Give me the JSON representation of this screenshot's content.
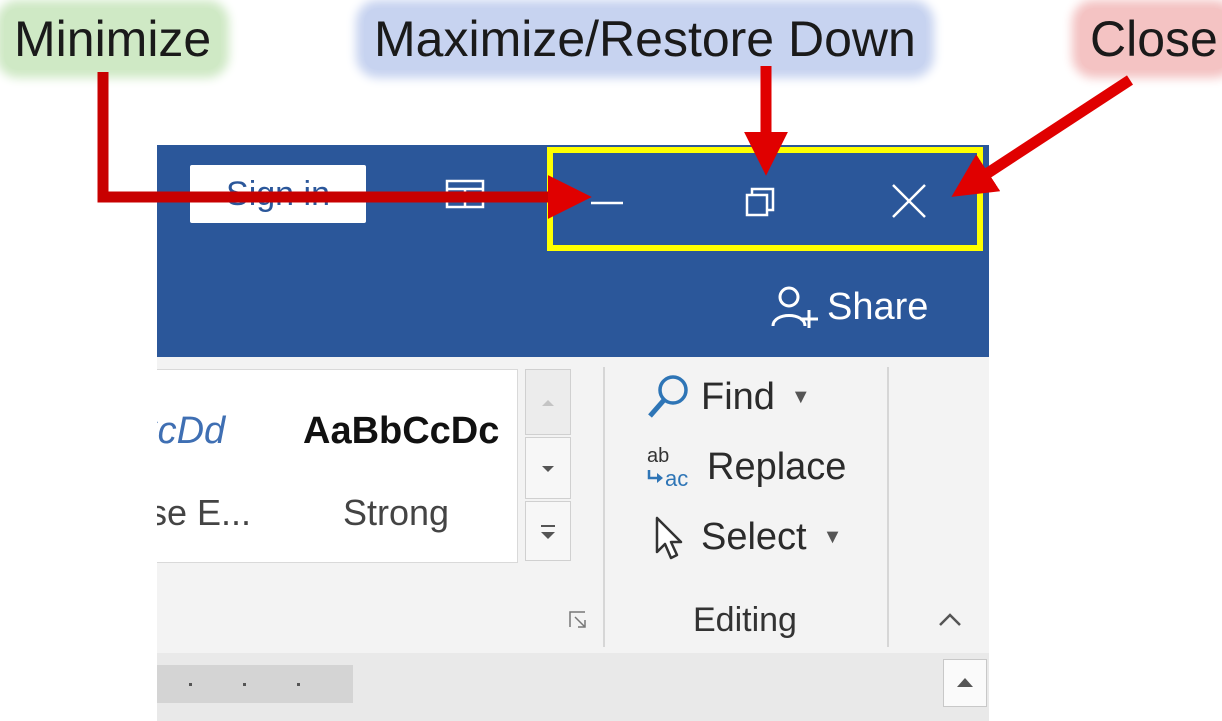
{
  "callouts": {
    "minimize": "Minimize",
    "maximize": "Maximize/Restore Down",
    "close": "Close"
  },
  "titlebar": {
    "sign_in": "Sign in",
    "share": "Share",
    "controls": [
      "minimize-icon",
      "restore-icon",
      "close-icon"
    ]
  },
  "ribbon": {
    "styles": [
      {
        "sample": "AaBbCcDd",
        "name": "Subtle Emphasis"
      },
      {
        "sample": "AaBbCcDc",
        "name": "Strong"
      }
    ],
    "styles_visible": {
      "emph_sample": "oCcDd",
      "emph_name": "se E...",
      "strong_sample": "AaBbCcDc",
      "strong_name": "Strong"
    },
    "editing": {
      "find": "Find",
      "replace": "Replace",
      "select": "Select",
      "group_label": "Editing"
    }
  },
  "colors": {
    "title_bar": "#2b579a",
    "highlight_box": "#ffff00",
    "arrow": "#e00000",
    "minimize_callout_bg": "#cfe9c5",
    "maximize_callout_bg": "#c7d3f0",
    "close_callout_bg": "#f4c3c3"
  }
}
